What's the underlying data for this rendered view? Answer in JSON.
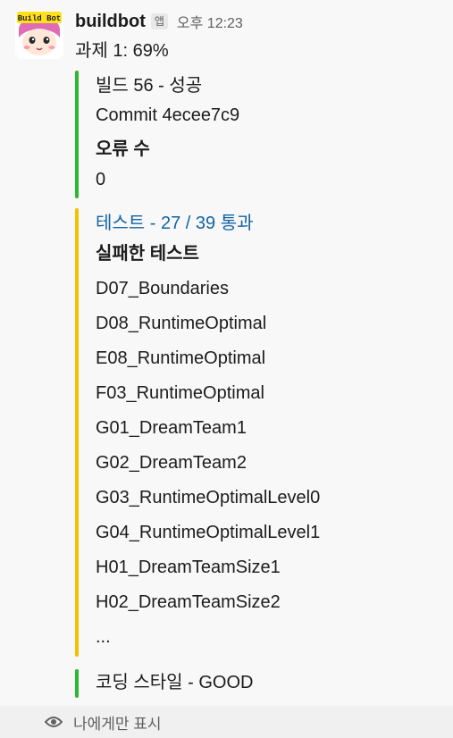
{
  "message": {
    "sender": "buildbot",
    "app_badge": "앱",
    "timestamp": "오후 12:23",
    "summary": "과제 1: 69%",
    "avatar": {
      "text": "Build Bot",
      "icon": "cartoon-face-avatar"
    }
  },
  "attachments": {
    "build": {
      "color": "#2eb82e",
      "title": "빌드 56 - 성공",
      "commit": "Commit 4ecee7c9",
      "error_label": "오류 수",
      "error_count": "0"
    },
    "tests": {
      "color": "#f2c200",
      "title": "테스트 - 27 / 39 통과",
      "failed_label": "실패한 테스트",
      "failed": [
        "D07_Boundaries",
        "D08_RuntimeOptimal",
        "E08_RuntimeOptimal",
        "F03_RuntimeOptimal",
        "G01_DreamTeam1",
        "G02_DreamTeam2",
        "G03_RuntimeOptimalLevel0",
        "G04_RuntimeOptimalLevel1",
        "H01_DreamTeamSize1",
        "H02_DreamTeamSize2",
        "..."
      ]
    },
    "style": {
      "color": "#2eb82e",
      "title": "코딩 스타일 - GOOD"
    }
  },
  "footer": {
    "icon": "eye-icon",
    "text": "나에게만 표시"
  }
}
